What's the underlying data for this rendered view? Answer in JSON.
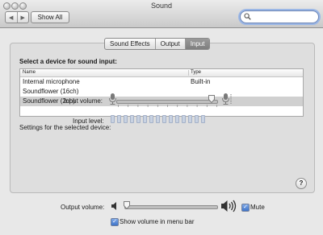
{
  "window": {
    "title": "Sound"
  },
  "toolbar": {
    "back_label": "◀",
    "forward_label": "▶",
    "show_all_label": "Show All",
    "search_value": "",
    "search_placeholder": ""
  },
  "tabs": [
    {
      "label": "Sound Effects",
      "active": false
    },
    {
      "label": "Output",
      "active": false
    },
    {
      "label": "Input",
      "active": true
    }
  ],
  "input_panel": {
    "heading": "Select a device for sound input:",
    "columns": [
      "Name",
      "Type"
    ],
    "devices": [
      {
        "name": "Internal microphone",
        "type": "Built-in",
        "selected": false
      },
      {
        "name": "Soundflower (16ch)",
        "type": "",
        "selected": false
      },
      {
        "name": "Soundflower (2ch)",
        "type": "",
        "selected": true
      }
    ],
    "settings_label": "Settings for the selected device:",
    "input_volume_label": "Input volume:",
    "input_volume_level": 0.95,
    "input_level_label": "Input level:",
    "input_level_segments": 15,
    "input_level_active": 0
  },
  "help_label": "?",
  "output": {
    "volume_label": "Output volume:",
    "volume_level": 0.0,
    "mute_label": "Mute",
    "mute_checked": true,
    "show_in_menubar_label": "Show volume in menu bar",
    "show_in_menubar_checked": true
  },
  "colors": {
    "focus_ring": "#9bb7e6",
    "checkbox": "#3f74c9",
    "selected_row": "#d0d0d0"
  }
}
